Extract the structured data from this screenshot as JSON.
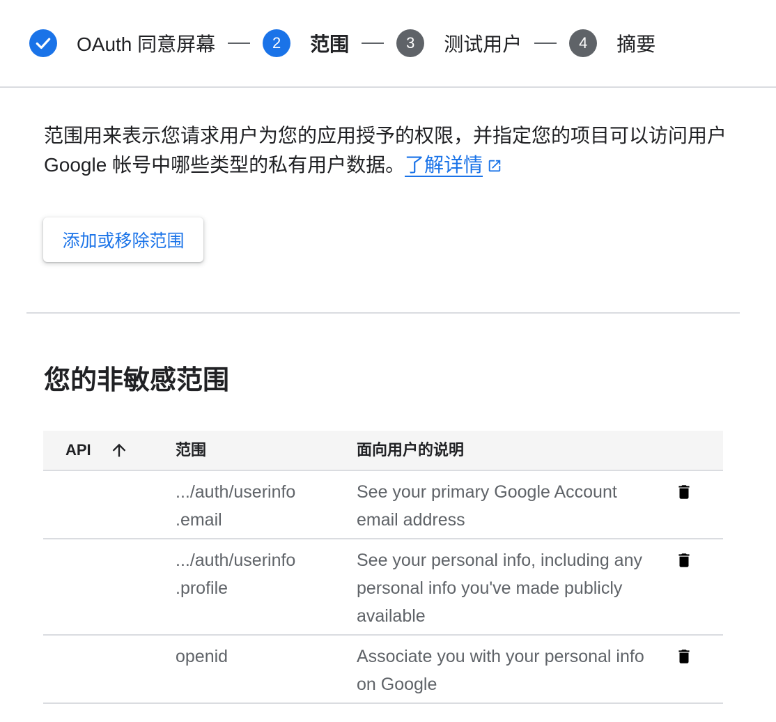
{
  "stepper": {
    "steps": [
      {
        "number": "",
        "label": "OAuth 同意屏幕",
        "state": "done"
      },
      {
        "number": "2",
        "label": "范围",
        "state": "active"
      },
      {
        "number": "3",
        "label": "测试用户",
        "state": "pending"
      },
      {
        "number": "4",
        "label": "摘要",
        "state": "pending"
      }
    ]
  },
  "description": {
    "text": "范围用来表示您请求用户为您的应用授予的权限，并指定您的项目可以访问用户 Google 帐号中哪些类型的私有用户数据。",
    "link_label": "了解详情"
  },
  "actions": {
    "add_remove_label": "添加或移除范围"
  },
  "section": {
    "title": "您的非敏感范围"
  },
  "table": {
    "headers": {
      "api": "API",
      "scope": "范围",
      "description": "面向用户的说明"
    },
    "rows": [
      {
        "api": "",
        "scope_line1": ".../auth/userinfo",
        "scope_line2": ".email",
        "description": "See your primary Google Account email address"
      },
      {
        "api": "",
        "scope_line1": ".../auth/userinfo",
        "scope_line2": ".profile",
        "description": "See your personal info, including any personal info you've made publicly available"
      },
      {
        "api": "",
        "scope_line1": "openid",
        "scope_line2": "",
        "description": "Associate you with your personal info on Google"
      }
    ]
  },
  "colors": {
    "accent": "#1a73e8",
    "pending_step": "#5f6368",
    "text_primary": "#202124",
    "text_secondary": "#5f6368",
    "header_bg": "#f5f5f5",
    "divider": "#dadce0"
  },
  "icons": {
    "done_step": "check-icon",
    "external_link": "open-in-new-icon",
    "sort": "arrow-upward-icon",
    "delete": "trash-icon"
  }
}
